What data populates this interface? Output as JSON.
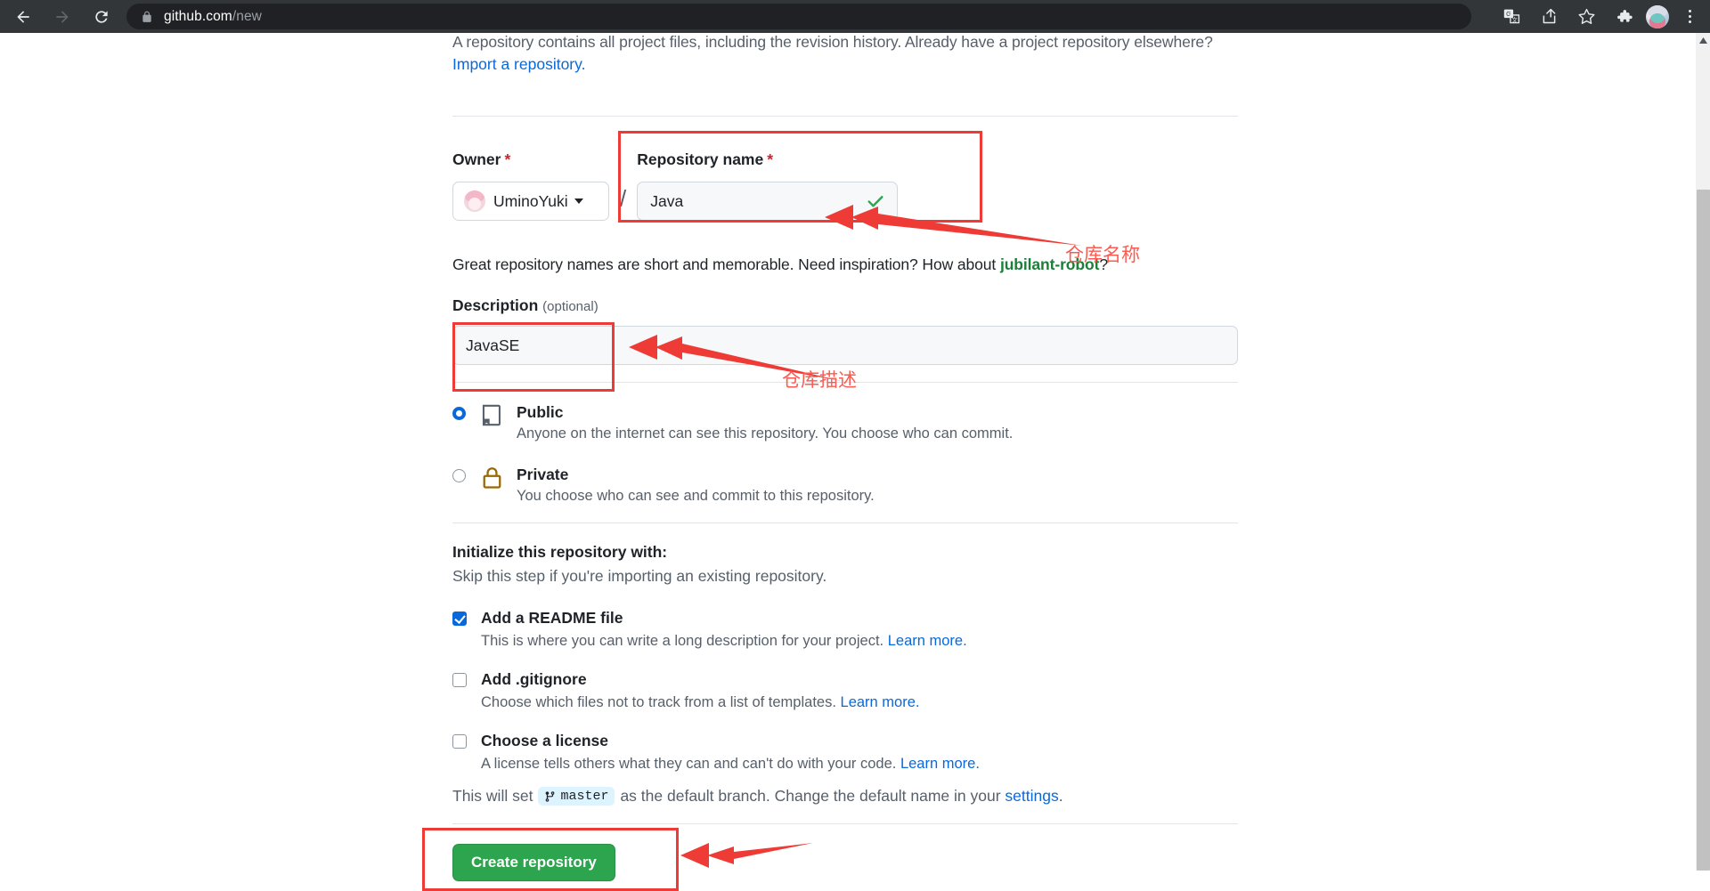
{
  "browser": {
    "back_icon": "back-arrow-icon",
    "forward_icon": "forward-arrow-icon",
    "reload_icon": "reload-icon",
    "lock_icon": "lock-icon",
    "url_host": "github.com",
    "url_path": "/new",
    "toolbar_icons": [
      "translate-icon",
      "share-icon",
      "bookmark-star-icon",
      "extensions-puzzle-icon",
      "profile-avatar",
      "chrome-menu-icon"
    ]
  },
  "page": {
    "lead_text": "A repository contains all project files, including the revision history. Already have a project repository elsewhere?",
    "import_link": "Import a repository.",
    "owner": {
      "label": "Owner",
      "required_mark": "*",
      "name": "UminoYuki",
      "separator": "/"
    },
    "repo_name": {
      "label": "Repository name",
      "required_mark": "*",
      "value": "Java",
      "placeholder": "",
      "valid_icon": "green-check-icon"
    },
    "name_hint": {
      "prefix": "Great repository names are short and memorable. Need inspiration? How about ",
      "suggestion": "jubilant-robot",
      "suffix": "?"
    },
    "description": {
      "label": "Description",
      "optional_label": "(optional)",
      "value": "JavaSE",
      "placeholder": ""
    },
    "visibility": [
      {
        "id": "public",
        "title": "Public",
        "desc": "Anyone on the internet can see this repository. You choose who can commit.",
        "selected": true,
        "icon": "repo-book-icon"
      },
      {
        "id": "private",
        "title": "Private",
        "desc": "You choose who can see and commit to this repository.",
        "selected": false,
        "icon": "lock-icon"
      }
    ],
    "initialize": {
      "title": "Initialize this repository with:",
      "subtitle": "Skip this step if you're importing an existing repository.",
      "options": [
        {
          "id": "readme",
          "title": "Add a README file",
          "desc": "This is where you can write a long description for your project.",
          "learn_more": "Learn more.",
          "checked": true
        },
        {
          "id": "gitignore",
          "title": "Add .gitignore",
          "desc": "Choose which files not to track from a list of templates.",
          "learn_more": "Learn more.",
          "checked": false
        },
        {
          "id": "license",
          "title": "Choose a license",
          "desc": "A license tells others what they can and can't do with your code.",
          "learn_more": "Learn more.",
          "checked": false
        }
      ]
    },
    "branch_note": {
      "prefix": "This will set",
      "branch_icon": "git-branch-icon",
      "branch_name": "master",
      "middle": "as the default branch. Change the default name in your",
      "settings_link": "settings",
      "period": "."
    },
    "submit_label": "Create repository"
  },
  "annotations": [
    {
      "id": "repo-name-note",
      "text": "仓库名称"
    },
    {
      "id": "description-note",
      "text": "仓库描述"
    }
  ],
  "colors": {
    "accent_green": "#2da44e",
    "link_blue": "#0969da",
    "annotation_red": "#ef3b35",
    "required_red": "#cf222e",
    "suggestion_green": "#1a7f37",
    "lock_gold": "#9a6700",
    "chrome_bg": "#323639"
  }
}
